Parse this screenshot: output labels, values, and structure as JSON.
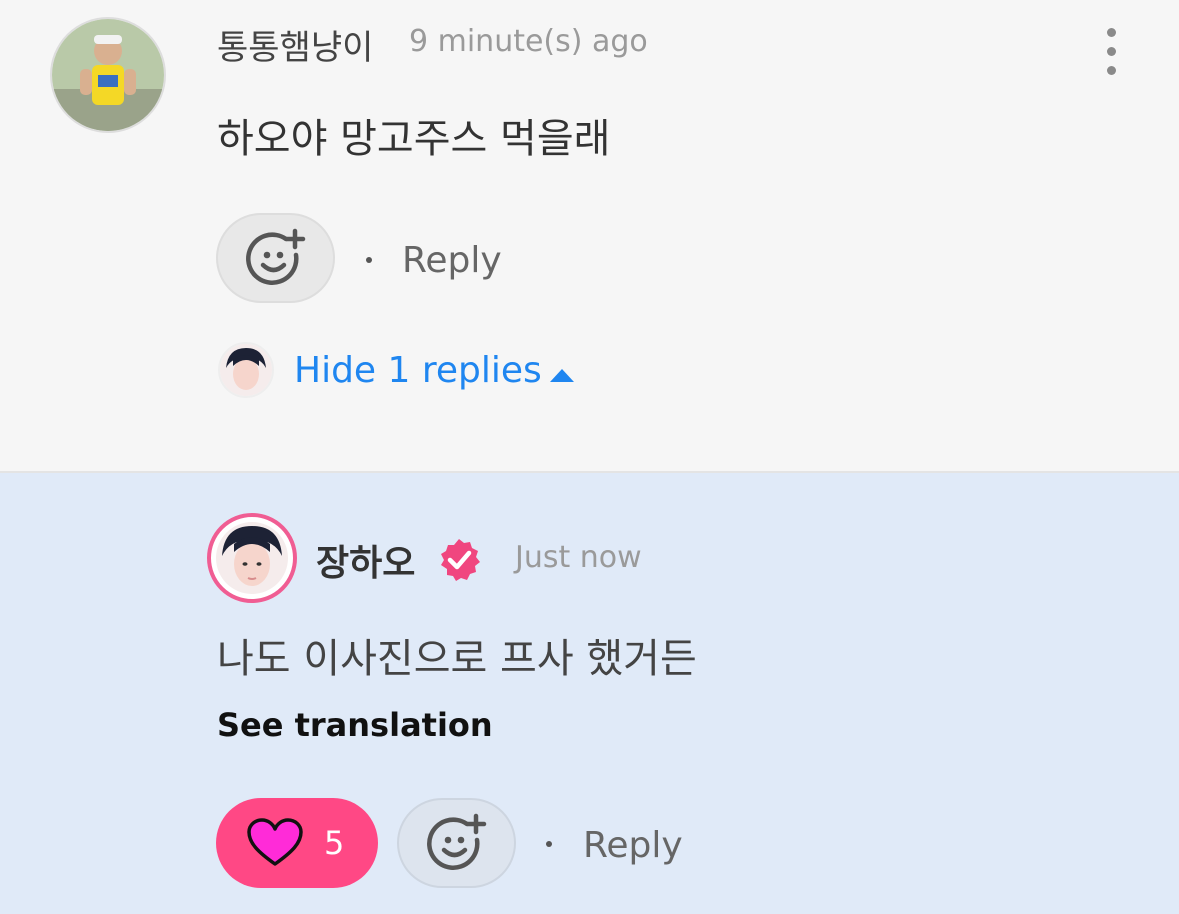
{
  "comment": {
    "username": "통통햄냥이",
    "time": "9 minute(s) ago",
    "text": "하오야 망고주스 먹을래",
    "reply_label": "Reply",
    "hide_replies_label": "Hide 1 replies"
  },
  "reply": {
    "username": "장하오",
    "time": "Just now",
    "text": "나도 이사진으로 프사 했거든",
    "see_translation_label": "See translation",
    "like_count": "5",
    "reply_label": "Reply"
  },
  "colors": {
    "top_background": "#f6f6f6",
    "reply_background": "#e0eaf8",
    "accent_blue": "#1f86f0",
    "like_pink": "#ff4885",
    "verified_pink": "#f05d93"
  },
  "icons": [
    "more-vertical-icon",
    "add-emoji-icon",
    "caret-up-icon",
    "verified-badge-icon",
    "heart-icon"
  ]
}
